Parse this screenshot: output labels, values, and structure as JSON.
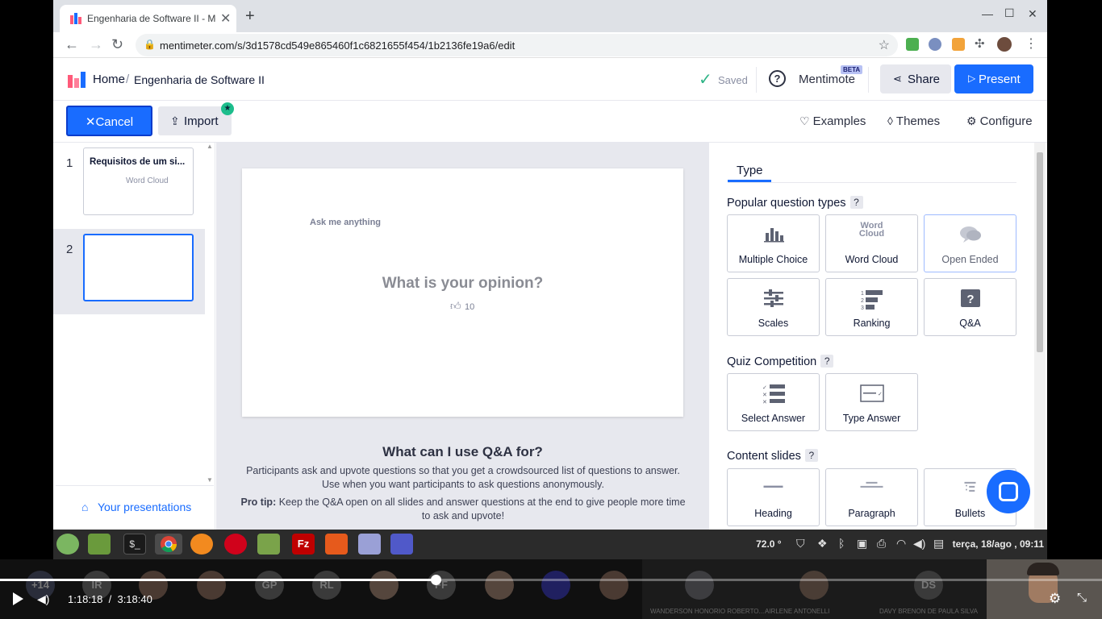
{
  "browser": {
    "tab_title": "Engenharia de Software II - Me",
    "url": "mentimeter.com/s/3d1578cd549e865460f1c6821655f454/1b2136fe19a6/edit",
    "new_tab": "+",
    "tab_close": "✕",
    "win_min": "—",
    "win_max": "☐",
    "win_close": "✕"
  },
  "header": {
    "home": "Home",
    "sep": "/",
    "title": "Engenharia de Software II",
    "saved": "Saved",
    "mentimote": "Mentimote",
    "beta": "BETA",
    "share": "Share",
    "present": "Present"
  },
  "subbar": {
    "cancel": "Cancel",
    "import": "Import",
    "examples": "Examples",
    "themes": "Themes",
    "configure": "Configure"
  },
  "slides": [
    {
      "num": "1",
      "title": "Requisitos de um si...",
      "thumb_label": "Word Cloud"
    },
    {
      "num": "2",
      "title": ""
    }
  ],
  "your_presentations": "Your presentations",
  "canvas": {
    "ask_me": "Ask me anything",
    "question": "What is your opinion?",
    "upvotes": "10",
    "qa_heading": "What can I use Q&A for?",
    "qa_p1": "Participants ask and upvote questions so that you get a crowdsourced list of questions to answer. Use when you want participants to ask questions anonymously.",
    "qa_tip_label": "Pro tip:",
    "qa_tip": "Keep the Q&A open on all slides and answer questions at the end to give people more time to ask and upvote!"
  },
  "typepanel": {
    "tab": "Type",
    "popular_title": "Popular question types",
    "popular": [
      {
        "label": "Multiple Choice",
        "icon": "bar-chart-icon"
      },
      {
        "label": "Word Cloud",
        "icon": "word-cloud-icon"
      },
      {
        "label": "Open Ended",
        "icon": "speech-bubbles-icon"
      },
      {
        "label": "Scales",
        "icon": "sliders-icon"
      },
      {
        "label": "Ranking",
        "icon": "ranking-icon"
      },
      {
        "label": "Q&A",
        "icon": "qa-icon"
      }
    ],
    "quiz_title": "Quiz Competition",
    "quiz": [
      {
        "label": "Select Answer",
        "icon": "checklist-icon"
      },
      {
        "label": "Type Answer",
        "icon": "text-input-icon"
      }
    ],
    "content_title": "Content slides",
    "content": [
      {
        "label": "Heading",
        "icon": "heading-icon"
      },
      {
        "label": "Paragraph",
        "icon": "paragraph-icon"
      },
      {
        "label": "Bullets",
        "icon": "bullets-icon"
      }
    ],
    "help": "?"
  },
  "taskbar": {
    "temperature": "72.0 °",
    "datetime": "terça, 18/ago , 09:11"
  },
  "callbar": {
    "overflow": "+14",
    "avatars": [
      "IR",
      "GP",
      "RL",
      "FF"
    ],
    "named": [
      {
        "initials": "",
        "name": "WANDERSON HONORIO ROBERTO..."
      },
      {
        "initials": "",
        "name": "AIRLENE ANTONELLI"
      },
      {
        "initials": "DS",
        "name": "DAVY BRENON DE PAULA SILVA"
      }
    ],
    "current_time": "1:18:18",
    "time_sep": "/",
    "total_time": "3:18:40",
    "progress": 0.395
  }
}
